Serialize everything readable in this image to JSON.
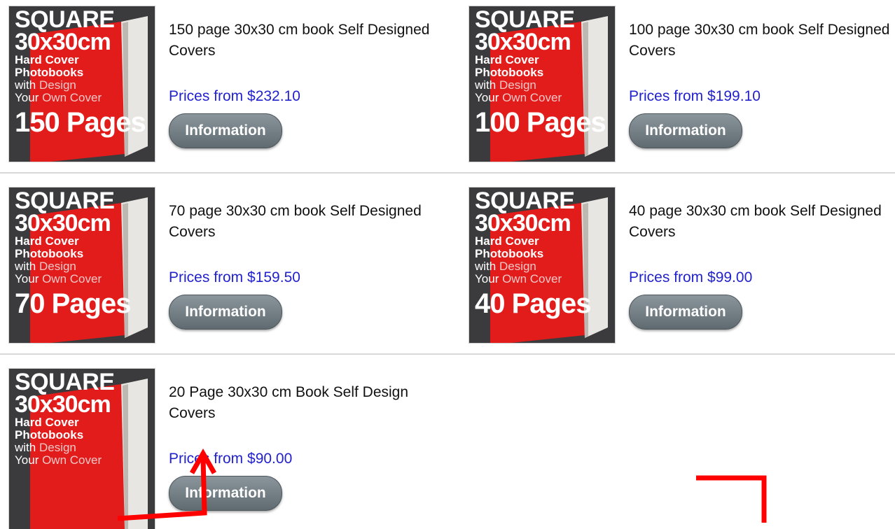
{
  "thumbnail_common": {
    "line1": "SQUARE",
    "line2": "30x30cm",
    "line3": "Hard Cover",
    "line4": "Photobooks",
    "line5_prefix": "with ",
    "line5_hl": "Design",
    "line6_prefix": "Your ",
    "line6_hl": "Own Cover"
  },
  "products": [
    {
      "pages_badge": "150 Pages",
      "title": "150 page 30x30 cm book Self Designed Covers",
      "price": "Prices from $232.10",
      "button": "Information"
    },
    {
      "pages_badge": "100 Pages",
      "title": "100 page 30x30 cm book Self Designed Covers",
      "price": "Prices from $199.10",
      "button": "Information"
    },
    {
      "pages_badge": "70 Pages",
      "title": "70 page 30x30 cm book Self Designed Covers",
      "price": "Prices from $159.50",
      "button": "Information"
    },
    {
      "pages_badge": "40 Pages",
      "title": "40 page 30x30 cm book Self Designed Covers",
      "price": "Prices from $99.00",
      "button": "Information"
    },
    {
      "pages_badge": "",
      "title": "20 Page 30x30 cm Book Self Design Covers",
      "price": "Prices from $90.00",
      "button": "Information"
    }
  ],
  "colors": {
    "price_link": "#2222cc",
    "button_bg": "#6e7a80",
    "thumb_red": "#e21b1b",
    "thumb_dark": "#3b3b3d",
    "annotation_red": "#ff0000"
  }
}
